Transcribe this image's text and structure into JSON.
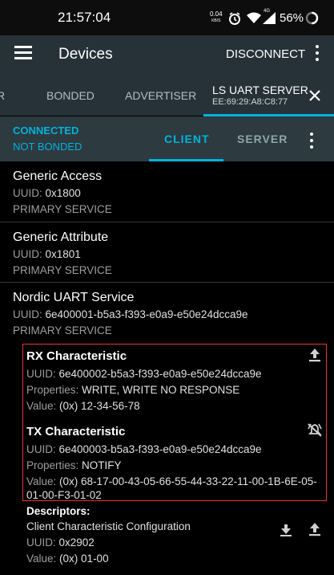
{
  "status_bar": {
    "time": "21:57:04",
    "net_speed_value": "0.04",
    "net_speed_unit": "KB/S",
    "network_type": "4G",
    "battery": "56%"
  },
  "app_bar": {
    "title": "Devices",
    "disconnect_label": "DISCONNECT"
  },
  "tabs": {
    "partial": "R",
    "bonded": "BONDED",
    "advertiser": "ADVERTISER",
    "server_name": "LS UART SERVER",
    "server_address": "EE:69:29:A8:C8:77"
  },
  "connection": {
    "state": "CONNECTED",
    "bond_state": "NOT BONDED",
    "client_tab": "CLIENT",
    "server_tab": "SERVER"
  },
  "labels": {
    "uuid": "UUID:",
    "properties": "Properties:",
    "value": "Value:",
    "descriptors": "Descriptors:"
  },
  "services": [
    {
      "name": "Generic Access",
      "uuid": "0x1800",
      "type": "PRIMARY SERVICE"
    },
    {
      "name": "Generic Attribute",
      "uuid": "0x1801",
      "type": "PRIMARY SERVICE"
    },
    {
      "name": "Nordic UART Service",
      "uuid": "6e400001-b5a3-f393-e0a9-e50e24dcca9e",
      "type": "PRIMARY SERVICE"
    }
  ],
  "characteristics": [
    {
      "name": "RX Characteristic",
      "uuid": "6e400002-b5a3-f393-e0a9-e50e24dcca9e",
      "properties": "WRITE, WRITE NO RESPONSE",
      "value": "(0x) 12-34-56-78"
    },
    {
      "name": "TX Characteristic",
      "uuid": "6e400003-b5a3-f393-e0a9-e50e24dcca9e",
      "properties": "NOTIFY",
      "value_line1": "(0x) 68-17-00-43-05-66-55-44-33-22-11-00-1B-6E-05-",
      "value_line2": "01-00-F3-01-02"
    }
  ],
  "descriptor": {
    "name": "Client Characteristic Configuration",
    "uuid": "0x2902",
    "value": "(0x) 01-00"
  },
  "colors": {
    "accent": "#00b3dc",
    "app_bar": "#263238",
    "highlight_border": "#e53935"
  }
}
